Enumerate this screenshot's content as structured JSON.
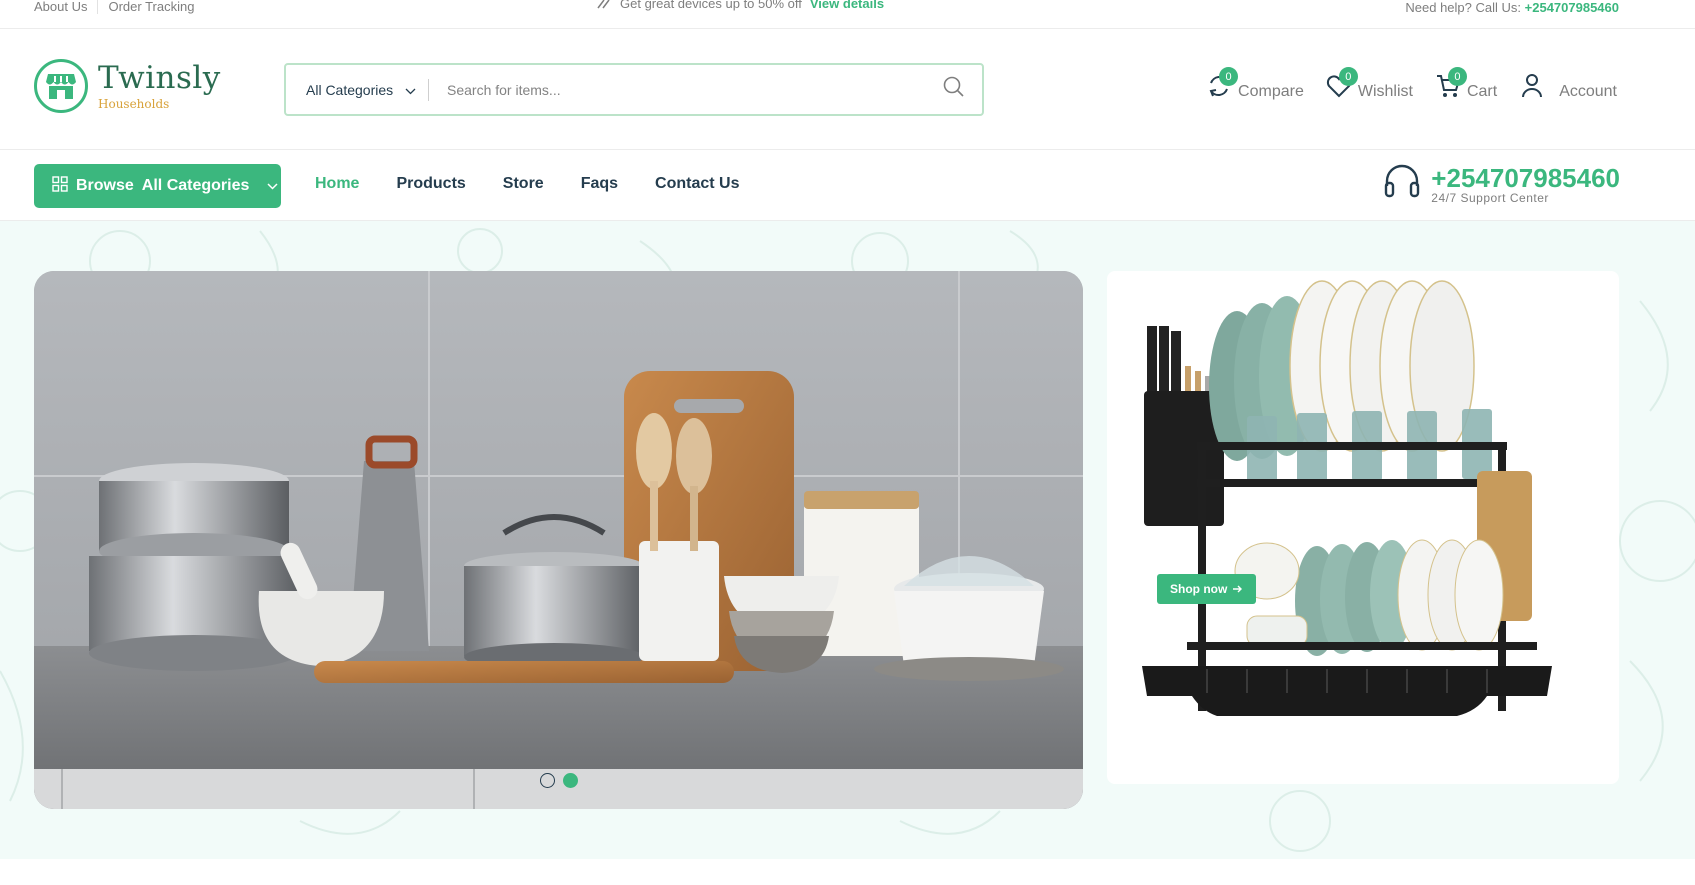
{
  "topbar": {
    "links": [
      "About Us",
      "Order Tracking"
    ],
    "promo_text": "Get great devices up to 50% off",
    "promo_link": "View details",
    "help_text": "Need help? Call Us:",
    "help_phone": "+254707985460"
  },
  "logo": {
    "name": "Twinsly",
    "tagline": "Households"
  },
  "search": {
    "category": "All Categories",
    "placeholder": "Search for items..."
  },
  "header_actions": [
    {
      "label": "Compare",
      "badge": "0",
      "icon": "compare-icon"
    },
    {
      "label": "Wishlist",
      "badge": "0",
      "icon": "heart-icon"
    },
    {
      "label": "Cart",
      "badge": "0",
      "icon": "cart-icon"
    },
    {
      "label": "Account",
      "icon": "user-icon"
    }
  ],
  "nav": {
    "browse_prefix": "Browse",
    "browse_label": "All Categories",
    "menu": [
      "Home",
      "Products",
      "Store",
      "Faqs",
      "Contact Us"
    ],
    "active": "Home",
    "support_phone": "+254707985460",
    "support_sub": "24/7 Support Center"
  },
  "hero": {
    "slide_count": 2,
    "active_slide": 2,
    "promo_button": "Shop now"
  },
  "colors": {
    "brand": "#3bb77e",
    "text": "#253d4e",
    "hero_bg": "#f2fbf9",
    "accent_gold": "#d8a23a"
  }
}
